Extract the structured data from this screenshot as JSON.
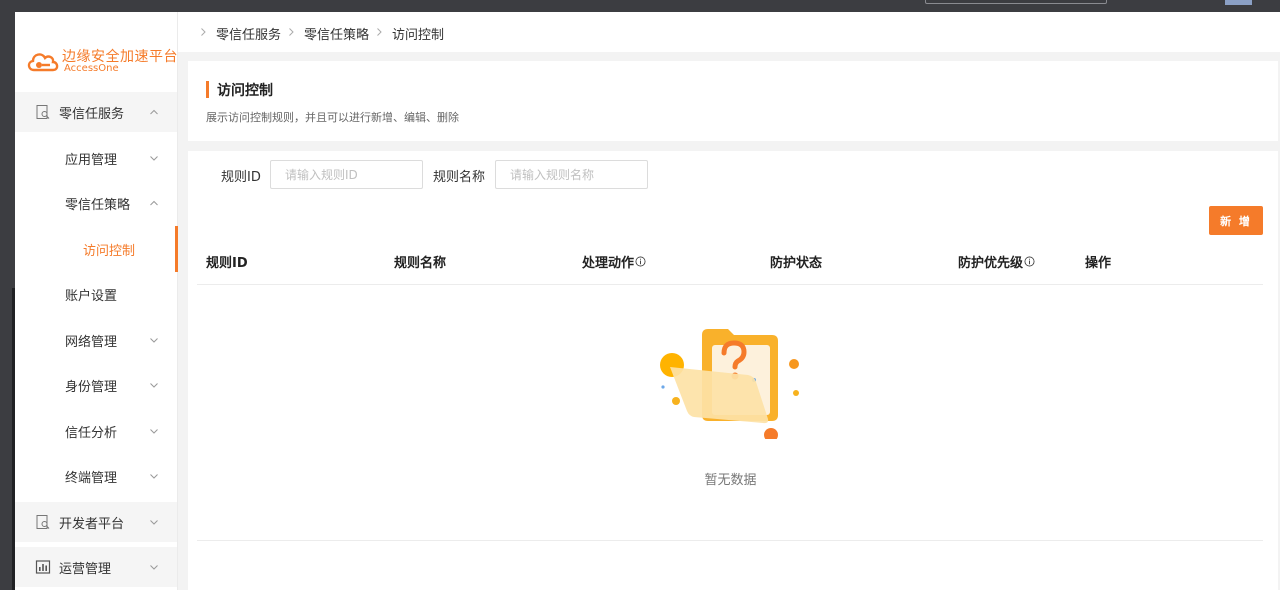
{
  "brand": {
    "name_cn": "边缘安全加速平台",
    "name_en": "AccessOne",
    "accent_color": "#f57b2a"
  },
  "sidebar": {
    "items": [
      {
        "label": "零信任服务",
        "level": 1,
        "icon": "doc-search-icon",
        "expanded": true
      },
      {
        "label": "应用管理",
        "level": 2,
        "expanded": false
      },
      {
        "label": "零信任策略",
        "level": 2,
        "expanded": true
      },
      {
        "label": "访问控制",
        "level": 3,
        "active": true
      },
      {
        "label": "账户设置",
        "level": 2
      },
      {
        "label": "网络管理",
        "level": 2,
        "expanded": false
      },
      {
        "label": "身份管理",
        "level": 2,
        "expanded": false
      },
      {
        "label": "信任分析",
        "level": 2,
        "expanded": false
      },
      {
        "label": "终端管理",
        "level": 2,
        "expanded": false
      },
      {
        "label": "开发者平台",
        "level": 1,
        "icon": "doc-search-icon",
        "expanded": false
      },
      {
        "label": "运营管理",
        "level": 1,
        "icon": "bar-chart-icon",
        "expanded": false
      }
    ]
  },
  "breadcrumb": [
    "零信任服务",
    "零信任策略",
    "访问控制"
  ],
  "header": {
    "title": "访问控制",
    "description": "展示访问控制规则，并且可以进行新增、编辑、删除"
  },
  "filters": {
    "rule_id_label": "规则ID",
    "rule_id_placeholder": "请输入规则ID",
    "rule_id_value": "",
    "rule_name_label": "规则名称",
    "rule_name_placeholder": "请输入规则名称",
    "rule_name_value": ""
  },
  "add_button": "新 增",
  "table": {
    "columns": [
      {
        "label": "规则ID",
        "info": false
      },
      {
        "label": "规则名称",
        "info": false
      },
      {
        "label": "处理动作",
        "info": true
      },
      {
        "label": "防护状态",
        "info": false
      },
      {
        "label": "防护优先级",
        "info": true
      },
      {
        "label": "操作",
        "info": false
      }
    ],
    "rows": [],
    "empty_text": "暂无数据"
  }
}
